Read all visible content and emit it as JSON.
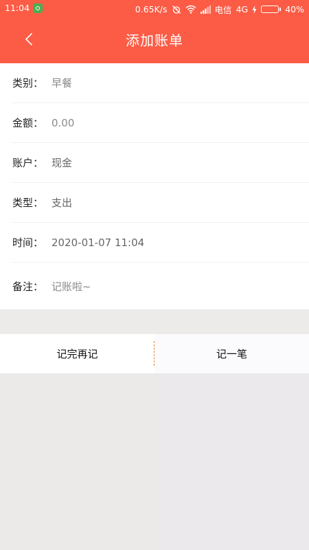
{
  "status_bar": {
    "time": "11:04",
    "speed": "0.65K/s",
    "carrier": "电信",
    "network": "4G",
    "battery_percent": "40%",
    "battery_level": 0.4
  },
  "nav": {
    "back_icon": "chevron-left-icon",
    "title": "添加账单"
  },
  "form": {
    "rows": [
      {
        "label": "类别：",
        "value": "早餐"
      },
      {
        "label": "金额：",
        "value": "0.00"
      },
      {
        "label": "账户：",
        "value": "现金"
      },
      {
        "label": "类型：",
        "value": "支出"
      },
      {
        "label": "时间：",
        "value": "2020-01-07 11:04"
      },
      {
        "label": "备注：",
        "placeholder": "记账啦~"
      }
    ]
  },
  "actions": {
    "save_and_continue": "记完再记",
    "save": "记一笔"
  },
  "colors": {
    "header": "#fc5c46",
    "divider_accent": "#e48a3c"
  }
}
